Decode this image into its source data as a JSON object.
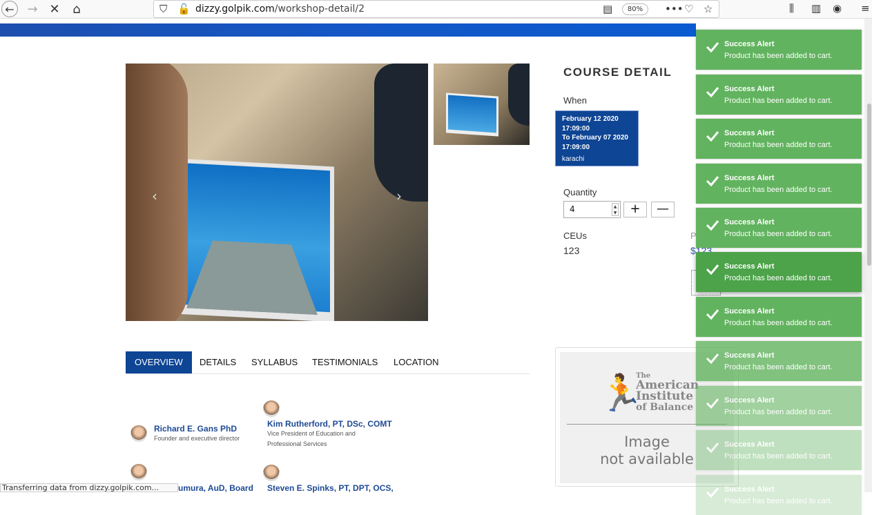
{
  "browser": {
    "url_host": "dizzy.golpik.com",
    "url_path": "/workshop-detail/2",
    "zoom": "80%",
    "status_text": "Transferring data from dizzy.golpik.com..."
  },
  "course": {
    "title": "COURSE DETAIL",
    "when_label": "When",
    "when_start": "February 12 2020 17:09:00",
    "when_end": "To February 07 2020 17:09:00",
    "location": "karachi",
    "quantity_label": "Quantity",
    "quantity_value": "4",
    "plus": "+",
    "minus": "—",
    "ceus_label": "CEUs",
    "ceus_value": "123",
    "price_label": "Price",
    "price_value": "$123"
  },
  "tabs": [
    "OVERVIEW",
    "DETAILS",
    "SYLLABUS",
    "TESTIMONIALS",
    "LOCATION"
  ],
  "placeholder": {
    "logo_line1": "The",
    "logo_line2": "American",
    "logo_line3": "Institute",
    "logo_line4": "of Balance",
    "text_line1": "Image",
    "text_line2": "not available"
  },
  "people": [
    {
      "name": "Richard E. Gans PhD",
      "role": "Founder and executive director"
    },
    {
      "name": "Kim Rutherford, PT, DSc, COMT",
      "role1": "Vice President of Education and",
      "role2": "Professional Services"
    },
    {
      "name": "umura, AuD, Board"
    },
    {
      "name": "Steven E. Spinks, PT, DPT, OCS,"
    }
  ],
  "toast": {
    "title": "Success Alert",
    "message": "Product has been added to cart."
  },
  "colors": {
    "toast": "#62b35f",
    "primary": "#0e4594",
    "link": "#1d4a94"
  }
}
